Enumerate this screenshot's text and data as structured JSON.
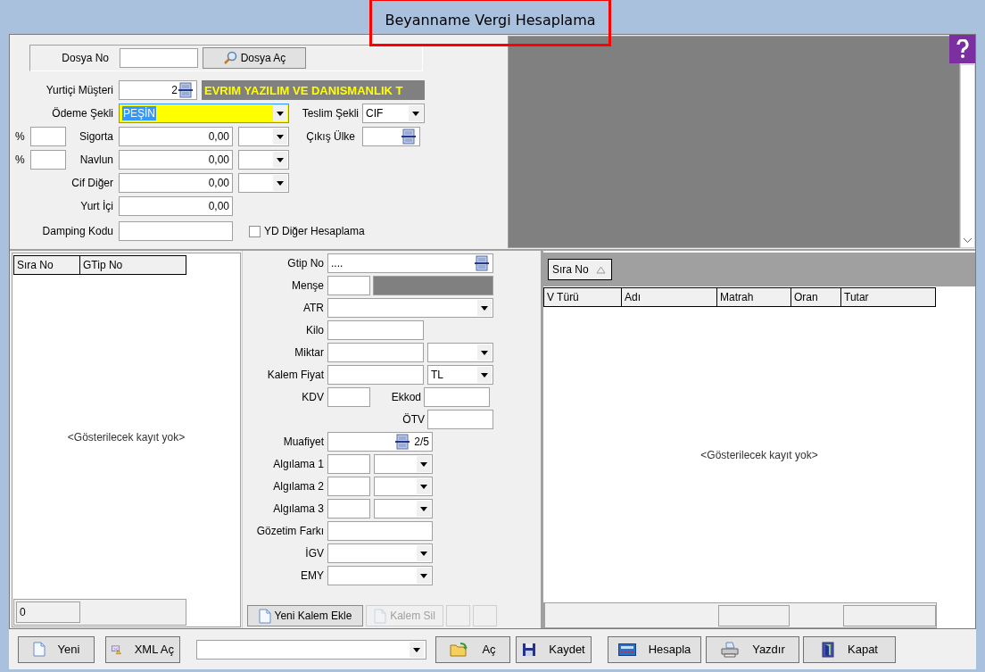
{
  "window": {
    "title": "Beyanname Vergi Hesaplama",
    "title_highlighted": true
  },
  "file_box": {
    "label": "Dosya No",
    "button": "Dosya Aç"
  },
  "customer": {
    "label": "Yurtiçi Müşteri",
    "value": "2",
    "name": "EVRIM YAZILIM VE DANISMANLIK T"
  },
  "payment": {
    "label": "Ödeme Şekli",
    "value": "PEŞİN",
    "focused": true,
    "text_selected": true
  },
  "delivery": {
    "label": "Teslim Şekli",
    "value": "CIF"
  },
  "cost_rows": [
    {
      "kind": "percent",
      "percent_sign": "%",
      "label": "Sigorta",
      "value": "0,00"
    },
    {
      "kind": "percent",
      "percent_sign": "%",
      "label": "Navlun",
      "value": "0,00"
    },
    {
      "kind": "plain",
      "label": "Cif Diğer",
      "value": "0,00"
    }
  ],
  "exit_country": {
    "label": "Çıkış Ülke"
  },
  "domestic": {
    "label": "Yurt İçi",
    "value": "0,00"
  },
  "dumping": {
    "label": "Damping Kodu"
  },
  "yd_other": {
    "label": "YD Diğer Hesaplama",
    "checked": false
  },
  "items_list": {
    "columns": [
      "Sıra No",
      "GTip No"
    ],
    "empty_text": "<Gösterilecek kayıt yok>",
    "footer_value": "0"
  },
  "item_form": {
    "rows": [
      {
        "kind": "lookup",
        "label": "Gtip No",
        "mask": "...."
      },
      {
        "kind": "code_name",
        "label": "Menşe"
      },
      {
        "kind": "combo",
        "label": "ATR"
      },
      {
        "kind": "text",
        "label": "Kilo"
      },
      {
        "kind": "text_combo",
        "label": "Miktar"
      },
      {
        "kind": "text_combo",
        "label": "Kalem Fiyat",
        "combo_value": "TL"
      },
      {
        "kind": "pair",
        "label": "KDV",
        "label_2": "Ekkod"
      },
      {
        "kind": "right",
        "label": "ÖTV"
      },
      {
        "kind": "lookup_counter",
        "label": "Muafiyet",
        "counter": "2/5"
      },
      {
        "kind": "short_combo",
        "label": "Algılama 1"
      },
      {
        "kind": "short_combo",
        "label": "Algılama 2"
      },
      {
        "kind": "short_combo",
        "label": "Algılama 3"
      },
      {
        "kind": "medium",
        "label": "Gözetim Farkı"
      },
      {
        "kind": "medium_combo",
        "label": "İGV"
      },
      {
        "kind": "medium_combo",
        "label": "EMY"
      }
    ],
    "buttons": [
      {
        "label": "Yeni Kalem Ekle",
        "disabled": false
      },
      {
        "label": "Kalem Sil",
        "disabled": true
      }
    ]
  },
  "tax_table": {
    "group_by": "Sıra No",
    "columns": [
      "V Türü",
      "Adı",
      "Matrah",
      "Oran",
      "Tutar"
    ],
    "empty_text": "<Gösterilecek kayıt yok>"
  },
  "toolbar": [
    {
      "kind": "button",
      "label": "Yeni"
    },
    {
      "kind": "button",
      "label": "XML Aç"
    },
    {
      "kind": "combo"
    },
    {
      "kind": "button",
      "label": "Aç"
    },
    {
      "kind": "button",
      "label": "Kaydet"
    },
    {
      "kind": "button",
      "label": "Hesapla"
    },
    {
      "kind": "button",
      "label": "Yazdır"
    },
    {
      "kind": "button",
      "label": "Kapat"
    }
  ]
}
